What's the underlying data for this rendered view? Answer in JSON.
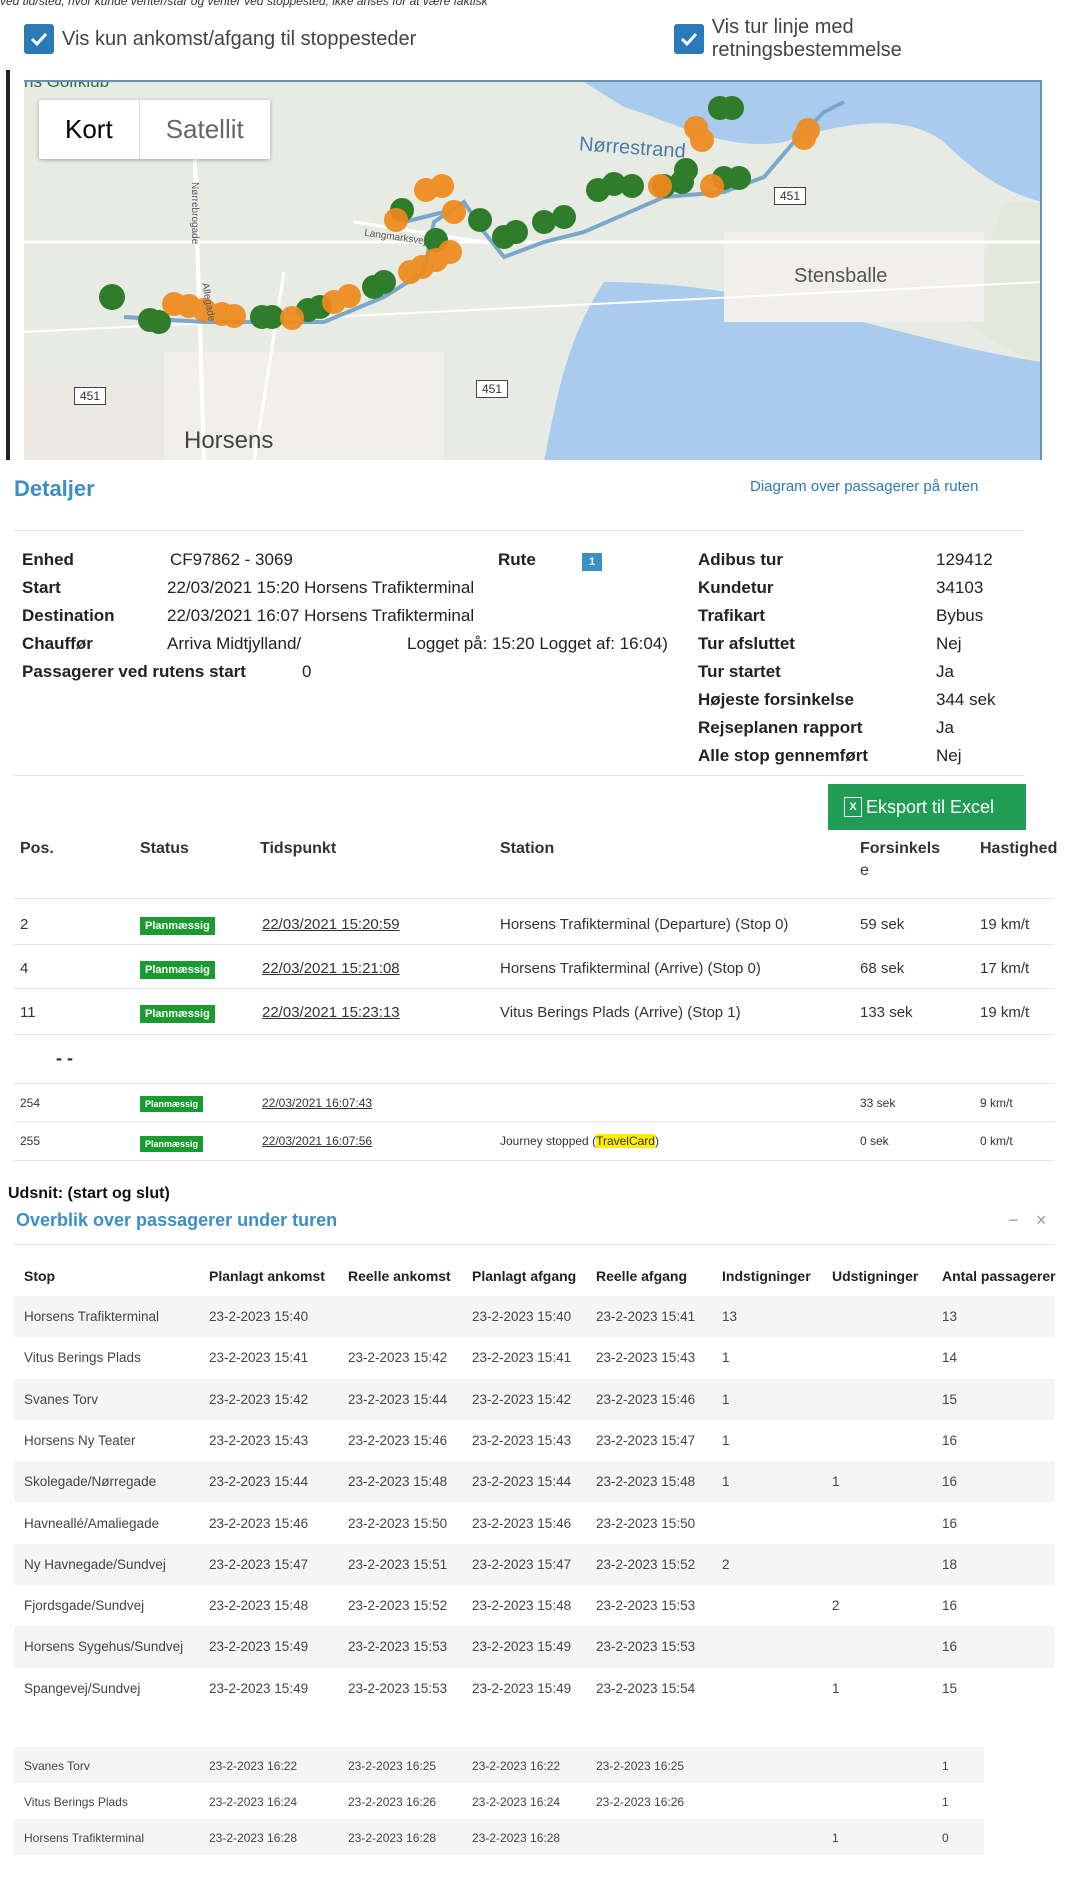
{
  "top_cut_text": "ved tid/sted, hvor kunde venter/står og venter ved stoppested, ikke anses for at være faktisk",
  "checkboxes": {
    "left": "Vis kun ankomst/afgang til stoppesteder",
    "right": "Vis tur linje med retningsbestemmelse"
  },
  "map": {
    "kort": "Kort",
    "satellit": "Satellit",
    "labels": {
      "golfklub": "ns Golfklub",
      "norrestrand": "Nørrestrand",
      "stensballe": "Stensballe",
      "horsens": "Horsens",
      "langmarksvej": "Langmarksvej",
      "norrebrogade": "Nørrebrogade",
      "allegade": "Allegade"
    },
    "shield": "451",
    "colors": {
      "green": "#2f7d2a",
      "orange": "#f08a1c",
      "route": "#7aa7cc",
      "water": "#a9cbee"
    }
  },
  "details": {
    "title": "Detaljer",
    "diagram_link": "Diagram over passagerer på ruten",
    "enhed_label": "Enhed",
    "enhed": "CF97862 - 3069",
    "rute_label": "Rute",
    "rute": "1",
    "start_label": "Start",
    "start": "22/03/2021 15:20 Horsens Trafikterminal",
    "destination_label": "Destination",
    "destination": "22/03/2021 16:07 Horsens Trafikterminal",
    "chauffor_label": "Chauffør",
    "chauffor": "Arriva Midtjylland/",
    "logget": "Logget på: 15:20 Logget af: 16:04)",
    "passagerer_label": "Passagerer ved rutens start",
    "passagerer": "0",
    "right": [
      {
        "label": "Adibus tur",
        "value": "129412"
      },
      {
        "label": "Kundetur",
        "value": "34103"
      },
      {
        "label": "Trafikart",
        "value": "Bybus"
      },
      {
        "label": "Tur afsluttet",
        "value": "Nej"
      },
      {
        "label": "Tur startet",
        "value": "Ja"
      },
      {
        "label": "Højeste forsinkelse",
        "value": "344 sek"
      },
      {
        "label": "Rejseplanen rapport",
        "value": "Ja"
      },
      {
        "label": "Alle stop gennemført",
        "value": "Nej"
      }
    ],
    "export": "Eksport til Excel"
  },
  "table1": {
    "headers": {
      "pos": "Pos.",
      "status": "Status",
      "tid": "Tidspunkt",
      "station": "Station",
      "forsinkelse": "Forsinkels",
      "forsinkelse2": "e",
      "hastighed": "Hastighed"
    },
    "rows": [
      {
        "pos": "2",
        "status": "Planmæssig",
        "tid": "22/03/2021 15:20:59",
        "station": "Horsens Trafikterminal (Departure) (Stop 0)",
        "forsinkelse": "59 sek",
        "hastighed": "19 km/t"
      },
      {
        "pos": "4",
        "status": "Planmæssig",
        "tid": "22/03/2021 15:21:08",
        "station": "Horsens Trafikterminal (Arrive) (Stop 0)",
        "forsinkelse": "68 sek",
        "hastighed": "17 km/t"
      },
      {
        "pos": "11",
        "status": "Planmæssig",
        "tid": "22/03/2021 15:23:13",
        "station": "Vitus Berings Plads (Arrive) (Stop 1)",
        "forsinkelse": "133 sek",
        "hastighed": "19 km/t"
      }
    ],
    "dashes": "-    -",
    "rows_end": [
      {
        "pos": "254",
        "status": "Planmæssig",
        "tid": "22/03/2021 16:07:43",
        "station": "",
        "forsinkelse": "33 sek",
        "hastighed": "9 km/t"
      },
      {
        "pos": "255",
        "status": "Planmæssig",
        "tid": "22/03/2021 16:07:56",
        "station_pre": "Journey stopped (",
        "station_hl": "TravelCard",
        "station_post": ")",
        "forsinkelse": "0 sek",
        "hastighed": "0 km/t"
      }
    ]
  },
  "udsnit": "Udsnit: (start og slut)",
  "overblik": {
    "title": "Overblik over passagerer under turen",
    "minimize": "−",
    "close": "×",
    "headers": [
      "Stop",
      "Planlagt ankomst",
      "Reelle ankomst",
      "Planlagt afgang",
      "Reelle afgang",
      "Indstigninger",
      "Udstigninger",
      "Antal passagerer"
    ],
    "rows": [
      [
        "Horsens Trafikterminal",
        "23-2-2023 15:40",
        "",
        "23-2-2023 15:40",
        "23-2-2023 15:41",
        "13",
        "",
        "13"
      ],
      [
        "Vitus Berings Plads",
        "23-2-2023 15:41",
        "23-2-2023 15:42",
        "23-2-2023 15:41",
        "23-2-2023 15:43",
        "1",
        "",
        "14"
      ],
      [
        "Svanes Torv",
        "23-2-2023 15:42",
        "23-2-2023 15:44",
        "23-2-2023 15:42",
        "23-2-2023 15:46",
        "1",
        "",
        "15"
      ],
      [
        "Horsens Ny Teater",
        "23-2-2023 15:43",
        "23-2-2023 15:46",
        "23-2-2023 15:43",
        "23-2-2023 15:47",
        "1",
        "",
        "16"
      ],
      [
        "Skolegade/Nørregade",
        "23-2-2023 15:44",
        "23-2-2023 15:48",
        "23-2-2023 15:44",
        "23-2-2023 15:48",
        "1",
        "1",
        "16"
      ],
      [
        "Havneallé/Amaliegade",
        "23-2-2023 15:46",
        "23-2-2023 15:50",
        "23-2-2023 15:46",
        "23-2-2023 15:50",
        "",
        "",
        "16"
      ],
      [
        "Ny Havnegade/Sundvej",
        "23-2-2023 15:47",
        "23-2-2023 15:51",
        "23-2-2023 15:47",
        "23-2-2023 15:52",
        "2",
        "",
        "18"
      ],
      [
        "Fjordsgade/Sundvej",
        "23-2-2023 15:48",
        "23-2-2023 15:52",
        "23-2-2023 15:48",
        "23-2-2023 15:53",
        "",
        "2",
        "16"
      ],
      [
        "Horsens Sygehus/Sundvej",
        "23-2-2023 15:49",
        "23-2-2023 15:53",
        "23-2-2023 15:49",
        "23-2-2023 15:53",
        "",
        "",
        "16"
      ],
      [
        "Spangevej/Sundvej",
        "23-2-2023 15:49",
        "23-2-2023 15:53",
        "23-2-2023 15:49",
        "23-2-2023 15:54",
        "",
        "1",
        "15"
      ]
    ],
    "rows_end": [
      [
        "Svanes Torv",
        "23-2-2023 16:22",
        "23-2-2023 16:25",
        "23-2-2023 16:22",
        "23-2-2023 16:25",
        "",
        "",
        "1"
      ],
      [
        "Vitus Berings Plads",
        "23-2-2023 16:24",
        "23-2-2023 16:26",
        "23-2-2023 16:24",
        "23-2-2023 16:26",
        "",
        "",
        "1"
      ],
      [
        "Horsens Trafikterminal",
        "23-2-2023 16:28",
        "23-2-2023 16:28",
        "23-2-2023 16:28",
        "",
        "",
        "1",
        "0"
      ]
    ]
  }
}
